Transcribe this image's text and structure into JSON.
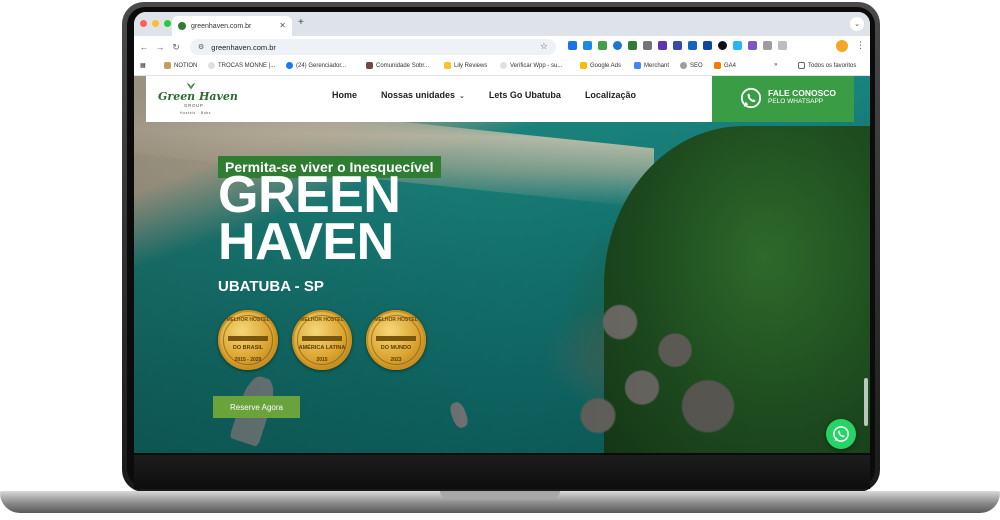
{
  "browser": {
    "tab_title": "greenhaven.com.br",
    "new_tab": "+",
    "url": "greenhaven.com.br",
    "bookmarks": [
      "NOTION",
      "TROCAS MONNE |...",
      "(24) Gerenciador...",
      "Comunidade Sobr...",
      "Lily Reviews",
      "Verificar Wpp - su...",
      "Google Ads",
      "Merchant",
      "SEO",
      "GA4"
    ],
    "more": "»",
    "all_favorites": "Todos os favoritos"
  },
  "site": {
    "logo": {
      "name": "Green Haven",
      "sub": "GROUP",
      "small": "Hostels · Bnbs"
    },
    "nav": [
      "Home",
      "Nossas unidades",
      "Lets Go Ubatuba",
      "Localização"
    ],
    "cta": {
      "line1": "FALE CONOSCO",
      "line2": "PELO WHATSAPP"
    },
    "hero": {
      "tagline": "Permita-se viver o Inesquecível",
      "title_line1": "GREEN",
      "title_line2": "HAVEN",
      "subtitle": "UBATUBA - SP",
      "medals": [
        {
          "top": "MELHOR HOSTEL",
          "mid": "DO BRASIL",
          "year": "2015 - 2020"
        },
        {
          "top": "MELHOR HOSTEL",
          "mid": "AMÉRICA LATINA",
          "year": "2015"
        },
        {
          "top": "MELHOR HOSTEL",
          "mid": "DO MUNDO",
          "year": "2023"
        }
      ],
      "button": "Reserve Agora"
    }
  },
  "colors": {
    "brand_green": "#2e7d32",
    "cta_green": "#3a9d45",
    "button_green": "#6aa23c",
    "whatsapp": "#25d366",
    "gold": "#d9a22e"
  }
}
